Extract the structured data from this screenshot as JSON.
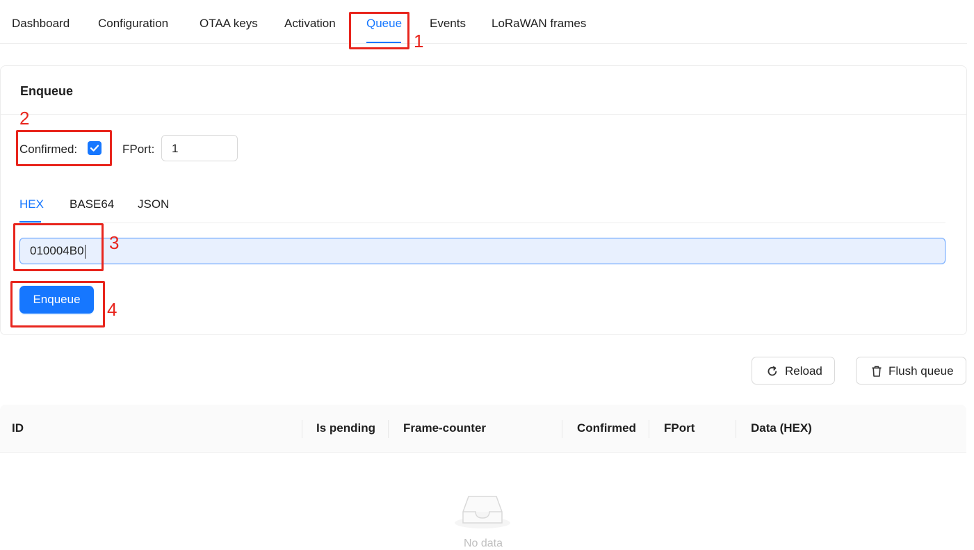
{
  "top_tabs": [
    "Dashboard",
    "Configuration",
    "OTAA keys",
    "Activation",
    "Queue",
    "Events",
    "LoRaWAN frames"
  ],
  "active_tab": "Queue",
  "enqueue": {
    "title": "Enqueue",
    "confirmed_label": "Confirmed",
    "confirmed_checked": true,
    "fport_label": "FPort",
    "fport_value": "1",
    "payload_tabs": [
      "HEX",
      "BASE64",
      "JSON"
    ],
    "active_payload_tab": "HEX",
    "hex_value": "010004B0",
    "submit_label": "Enqueue"
  },
  "annotations": [
    "1",
    "2",
    "3",
    "4"
  ],
  "actions": {
    "reload_label": "Reload",
    "flush_label": "Flush queue"
  },
  "table": {
    "columns": [
      "ID",
      "Is pending",
      "Frame-counter",
      "Confirmed",
      "FPort",
      "Data (HEX)"
    ],
    "empty_text": "No data"
  },
  "colors": {
    "primary": "#1677ff",
    "annotation": "#e8251d"
  }
}
